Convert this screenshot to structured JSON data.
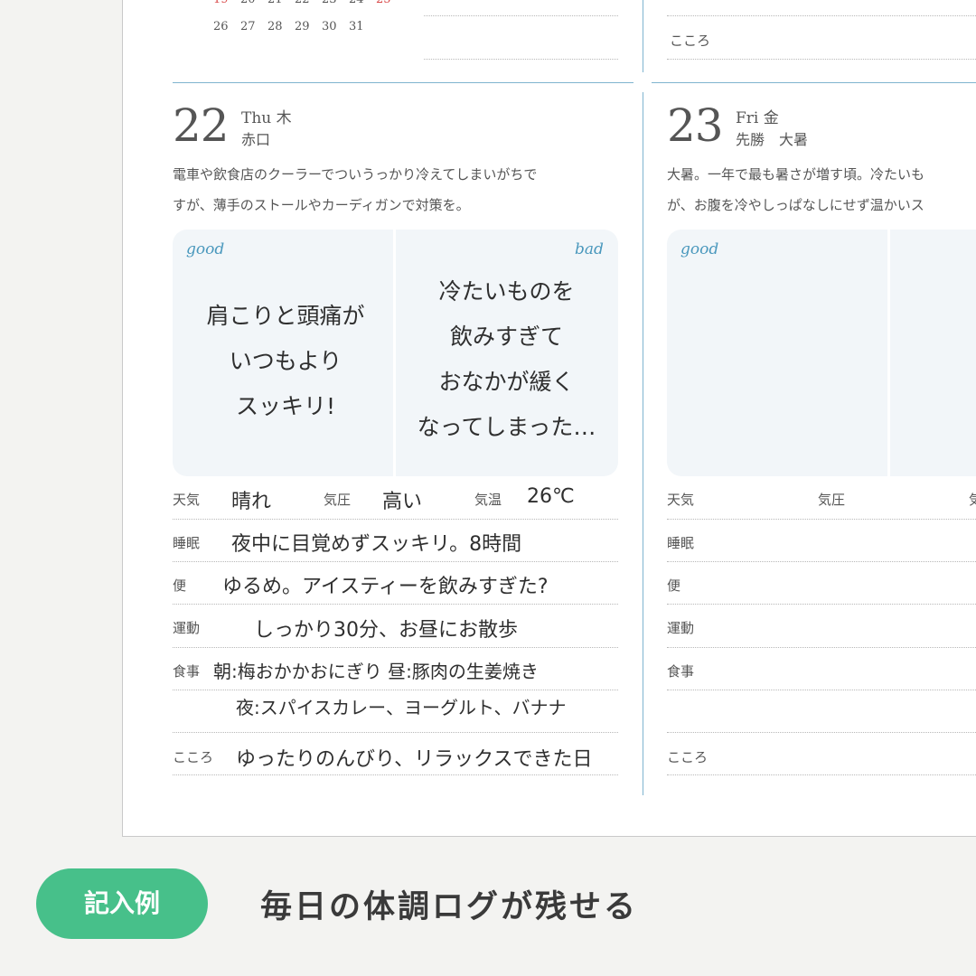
{
  "calendar": {
    "row_partial": [
      "19",
      "20",
      "21",
      "22",
      "23",
      "24",
      "25"
    ],
    "row_last": [
      "26",
      "27",
      "28",
      "29",
      "30",
      "31"
    ]
  },
  "prev_right": {
    "kokoro_label": "こころ"
  },
  "day22": {
    "number": "22",
    "dow": "Thu 木",
    "rokuyo": "赤口",
    "desc_line1": "電車や飲食店のクーラーでついうっかり冷えてしまいがちで",
    "desc_line2": "すが、薄手のストールやカーディガンで対策を。",
    "good_label": "good",
    "bad_label": "bad",
    "good_text": [
      "肩こりと頭痛が",
      "いつもより",
      "スッキリ!"
    ],
    "bad_text": [
      "冷たいものを",
      "飲みすぎて",
      "おなかが緩く",
      "なってしまった…"
    ],
    "labels": {
      "weather": "天気",
      "pressure": "気圧",
      "temp": "気温",
      "sleep": "睡眠",
      "bowel": "便",
      "exercise": "運動",
      "meal": "食事",
      "kokoro": "こころ"
    },
    "values": {
      "weather": "晴れ",
      "pressure": "高い",
      "temp": "26℃",
      "sleep": "夜中に目覚めずスッキリ。8時間",
      "bowel": "ゆるめ。アイスティーを飲みすぎた?",
      "exercise": "しっかり30分、お昼にお散歩",
      "meal1": "朝:梅おかかおにぎり 昼:豚肉の生姜焼き",
      "meal2": "夜:スパイスカレー、ヨーグルト、バナナ",
      "kokoro": "ゆったりのんびり、リラックスできた日"
    }
  },
  "day23": {
    "number": "23",
    "dow": "Fri 金",
    "rokuyo": "先勝　大暑",
    "desc_line1": "大暑。一年で最も暑さが増す頃。冷たいも",
    "desc_line2": "が、お腹を冷やしっぱなしにせず温かいス",
    "good_label": "good",
    "labels": {
      "weather": "天気",
      "pressure": "気圧",
      "temp": "気",
      "sleep": "睡眠",
      "bowel": "便",
      "exercise": "運動",
      "meal": "食事",
      "kokoro": "こころ"
    }
  },
  "footer": {
    "badge": "記入例",
    "caption": "毎日の体調ログが残せる"
  },
  "colors": {
    "accent_blue": "#4a98bd",
    "badge_green": "#47c08a",
    "sunday_red": "#d94a4a"
  }
}
